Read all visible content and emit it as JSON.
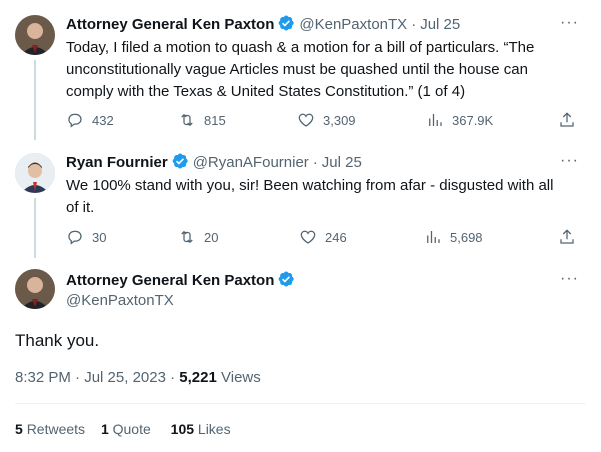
{
  "tweets": [
    {
      "name": "Attorney General Ken Paxton",
      "handle": "@KenPaxtonTX",
      "time": "Jul 25",
      "text": "Today, I filed a motion to quash & a motion for a bill of particulars. “The unconstitutionally vague Articles must be quashed until the house can comply with the Texas & United States Constitution.” (1 of 4)",
      "replies": "432",
      "retweets": "815",
      "likes": "3,309",
      "views": "367.9K"
    },
    {
      "name": "Ryan Fournier",
      "handle": "@RyanAFournier",
      "time": "Jul 25",
      "text": "We 100% stand with you, sir! Been watching from afar - disgusted with all of it.",
      "replies": "30",
      "retweets": "20",
      "likes": "246",
      "views": "5,698"
    }
  ],
  "main": {
    "name": "Attorney General Ken Paxton",
    "handle": "@KenPaxtonTX",
    "text": "Thank you.",
    "time": "8:32 PM",
    "date": "Jul 25, 2023",
    "views_count": "5,221",
    "views_label": "Views",
    "retweets_count": "5",
    "retweets_label": "Retweets",
    "quotes_count": "1",
    "quotes_label": "Quote",
    "likes_count": "105",
    "likes_label": "Likes"
  },
  "more_label": "···",
  "separator": "·",
  "icons": {
    "verified": "verified-badge-icon",
    "reply": "reply-icon",
    "retweet": "retweet-icon",
    "like": "heart-icon",
    "views": "analytics-icon",
    "share": "share-icon"
  },
  "colors": {
    "verified": "#1d9bf0",
    "muted": "#536471",
    "text": "#0f1419"
  }
}
